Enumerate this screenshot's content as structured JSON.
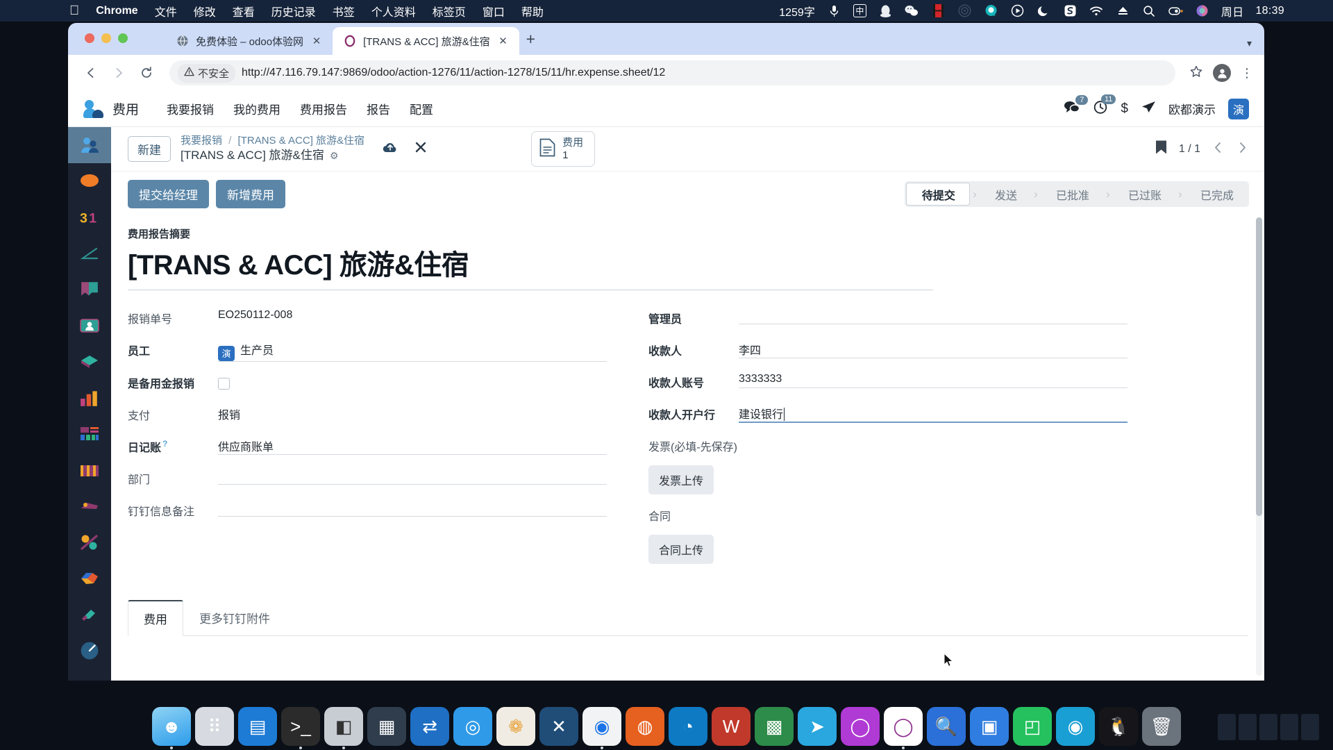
{
  "menubar": {
    "apple_icon": "apple-logo-icon",
    "app": "Chrome",
    "items": [
      "文件",
      "修改",
      "查看",
      "历史记录",
      "书签",
      "个人资料",
      "标签页",
      "窗口",
      "帮助"
    ],
    "word_count": "1259字",
    "ime": "中",
    "tray_icons": [
      "microphone-icon",
      "ime-chinese-icon",
      "qq-icon",
      "wechat-icon",
      "video-icon",
      "radar-icon",
      "search-assistant-icon",
      "player-icon",
      "moon-icon",
      "sogou-icon",
      "wifi-icon",
      "eject-icon",
      "spotlight-search-icon",
      "control-center-icon",
      "siri-icon"
    ],
    "day": "周日",
    "time": "18:39"
  },
  "browser": {
    "tabs": [
      {
        "title": "免费体验 – odoo体验网",
        "favicon": "globe-icon",
        "active": false
      },
      {
        "title": "[TRANS & ACC] 旅游&住宿",
        "favicon": "odoo-o-icon",
        "active": true
      }
    ],
    "new_tab_label": "+",
    "toolbar": {
      "back": "‹",
      "forward": "›",
      "reload": "⟳",
      "security_label": "不安全",
      "security_icon": "warning-triangle-icon",
      "url": "http://47.116.79.147:9869/odoo/action-1276/11/action-1278/15/11/hr.expense.sheet/12",
      "bookmark_icon": "star-icon",
      "profile_icon": "profile-avatar-icon",
      "menu_icon": "three-dot-menu-icon"
    }
  },
  "odoo": {
    "brand": "费用",
    "nav_items": [
      "我要报销",
      "我的费用",
      "费用报告",
      "报告",
      "配置"
    ],
    "messages_badge": "7",
    "activities_badge": "11",
    "currency_icon": "dollar-icon",
    "send_icon": "paper-plane-icon",
    "user_name": "欧都演示",
    "user_initial": "演",
    "appbar_icons": [
      "expenses-app-icon",
      "discuss-app-icon",
      "calendar-app-icon",
      "measure-app-icon",
      "knowledge-app-icon",
      "contacts-app-icon",
      "crm-app-icon",
      "sales-reporting-app-icon",
      "dashboard-app-icon",
      "pos-app-icon",
      "fleet-app-icon",
      "manufacturing-app-icon",
      "inventory-app-icon",
      "maintenance-app-icon",
      "timesheet-app-icon"
    ],
    "control_panel": {
      "new_button": "新建",
      "breadcrumb_parent": "我要报销",
      "breadcrumb_sep": "/",
      "breadcrumb_current": "[TRANS & ACC] 旅游&住宿",
      "record_title": "[TRANS & ACC] 旅游&住宿",
      "gear_icon": "gear-icon",
      "save_icon": "cloud-save-icon",
      "discard_icon": "discard-x-icon",
      "stat_button_label": "费用",
      "stat_button_value": "1",
      "stat_button_icon": "document-icon",
      "bookmark_icon": "bookmark-icon",
      "pager": "1 / 1",
      "prev_icon": "chevron-left-icon",
      "next_icon": "chevron-right-icon"
    },
    "actions": {
      "submit": "提交给经理",
      "add_expense": "新增费用"
    },
    "status_stages": [
      {
        "label": "待提交",
        "active": true
      },
      {
        "label": "发送",
        "active": false
      },
      {
        "label": "已批准",
        "active": false
      },
      {
        "label": "已过账",
        "active": false
      },
      {
        "label": "已完成",
        "active": false
      }
    ],
    "form": {
      "summary_label": "费用报告摘要",
      "title": "[TRANS & ACC] 旅游&住宿",
      "left_fields": [
        {
          "label": "报销单号",
          "value": "EO250112-008",
          "type": "text",
          "bold": false
        },
        {
          "label": "员工",
          "value": "生产员",
          "type": "m2o-tag",
          "tag": "演",
          "bold": true
        },
        {
          "label": "是备用金报销",
          "value": "",
          "type": "checkbox",
          "bold": true
        },
        {
          "label": "支付",
          "value": "报销",
          "type": "text",
          "bold": false
        },
        {
          "label": "日记账",
          "value": "供应商账单",
          "type": "m2o",
          "help": "?",
          "bold": true
        },
        {
          "label": "部门",
          "value": "",
          "type": "m2o",
          "bold": false
        },
        {
          "label": "钉钉信息备注",
          "value": "",
          "type": "m2o",
          "bold": false
        }
      ],
      "right_fields": [
        {
          "label": "管理员",
          "value": "",
          "type": "m2o",
          "bold": true
        },
        {
          "label": "收款人",
          "value": "李四",
          "type": "input",
          "bold": true
        },
        {
          "label": "收款人账号",
          "value": "3333333",
          "type": "input",
          "bold": true
        },
        {
          "label": "收款人开户行",
          "value": "建设银行",
          "type": "input-focused",
          "bold": true
        },
        {
          "label": "发票(必填-先保存)",
          "value": "",
          "type": "label-only",
          "bold": false
        },
        {
          "label": "",
          "value": "发票上传",
          "type": "upload-button",
          "bold": false
        },
        {
          "label": "合同",
          "value": "",
          "type": "label-only",
          "bold": false
        },
        {
          "label": "",
          "value": "合同上传",
          "type": "upload-button",
          "bold": false
        }
      ]
    },
    "notebook_tabs": [
      {
        "label": "费用",
        "active": true
      },
      {
        "label": "更多钉钉附件",
        "active": false
      }
    ]
  },
  "dock": {
    "icons": [
      "finder-icon",
      "launchpad-icon",
      "app-store-icon",
      "terminal-icon",
      "screenshot-icon",
      "preview-icon",
      "app-switcher-icon",
      "safari-icon",
      "photos-icon",
      "vscode-icon",
      "chrome-icon",
      "firefox-icon",
      "edge-icon",
      "wps-writer-icon",
      "wps-office-icon",
      "telegram-icon",
      "circle-app-icon",
      "odoo-icon",
      "search-app-icon",
      "wechat-work-icon",
      "teams-icon",
      "magnifier-icon",
      "qq-penguin-icon",
      "trash-icon"
    ],
    "colors": [
      "#2c9ceb",
      "#d7dae0",
      "#1d7bd6",
      "#2b2b2b",
      "#c8cdd4",
      "#2f86e0",
      "#1f6fc4",
      "#2f9ae8",
      "#e8e2da",
      "#1f4d78",
      "#f1f3f4",
      "#e66020",
      "#0e7ac4",
      "#c0392b",
      "#2d8c4a",
      "#2aa7df",
      "#b03ad4",
      "#8e2f8e",
      "#3a6fd8",
      "#2f7de0",
      "#4a5ed0",
      "#1a9fd4",
      "#16161a",
      "#c4c9cf"
    ]
  }
}
